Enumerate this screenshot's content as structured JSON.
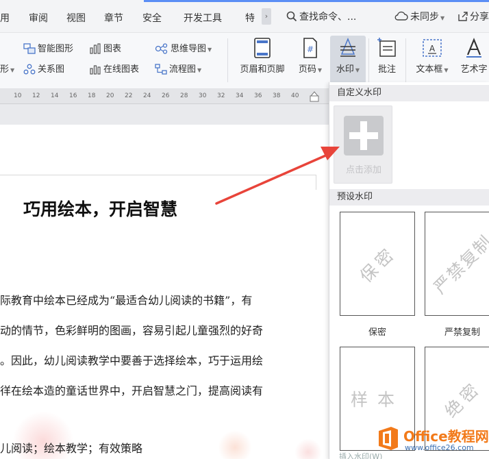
{
  "menubar": {
    "items": [
      "用",
      "审阅",
      "视图",
      "章节",
      "安全",
      "开发工具",
      "特"
    ],
    "scroll_glyph": "›",
    "search_text": "查找命令、...",
    "sync_label": "未同步",
    "share_label": "分享"
  },
  "ribbon": {
    "smart_art": "智能图形",
    "chart": "图表",
    "mind_map": "思维导图",
    "shape_fragment": "形",
    "relation": "关系图",
    "online_chart": "在线图表",
    "flowchart": "流程图",
    "header_footer": "页眉和页脚",
    "page_number": "页码",
    "watermark": "水印",
    "comment": "批注",
    "textbox": "文本框",
    "art_text": "艺术字"
  },
  "ruler": {
    "ticks": [
      "10",
      "12",
      "14",
      "16",
      "18",
      "20",
      "22",
      "24",
      "26",
      "28",
      "30",
      "32",
      "34",
      "36",
      "38",
      "40"
    ]
  },
  "document": {
    "title": "巧用绘本，开启智慧",
    "lines": [
      "际教育中绘本已经成为“最适合幼儿阅读的书籍”，有",
      "动的情节，色彩鲜明的图画，容易引起儿童强烈的好奇",
      "。因此，幼儿阅读教学中要善于选择绘本，巧于运用绘",
      "徉在绘本造的童话世界中，开启智慧之门，提高阅读有",
      "儿阅读；绘本教学；有效策略"
    ]
  },
  "watermark_panel": {
    "custom_header": "自定义水印",
    "add_label": "点击添加",
    "preset_header": "预设水印",
    "presets": [
      {
        "text": "保密",
        "label": "保密"
      },
      {
        "text": "严禁复制",
        "label": "严禁复制"
      },
      {
        "text": "样本",
        "label": ""
      },
      {
        "text": "绝密",
        "label": ""
      }
    ],
    "bottom_hint": "插入水印(W)"
  },
  "logo": {
    "name": "Office教程网",
    "url": "www.office26.com"
  },
  "colors": {
    "accent": "#5b8ef5",
    "arrow": "#e8443a",
    "logo_orange": "#f27a1a",
    "logo_blue": "#3a6fb2"
  }
}
